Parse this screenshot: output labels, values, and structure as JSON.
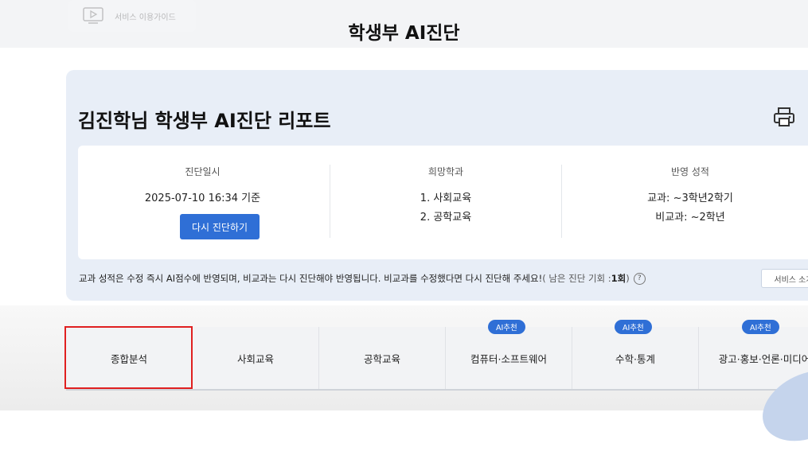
{
  "header": {
    "guide_label": "서비스 이용가이드",
    "title": "학생부 AI진단"
  },
  "report": {
    "title": "김진학님 학생부 AI진단 리포트",
    "print_icon": "printer-icon",
    "diagnosis_date": {
      "label": "진단일시",
      "value": "2025-07-10 16:34 기준",
      "button_label": "다시 진단하기"
    },
    "desired_majors": {
      "label": "희망학과",
      "items": [
        "1. 사회교육",
        "2. 공학교육"
      ]
    },
    "grades": {
      "label": "반영 성적",
      "subject": "교과: ~3학년2학기",
      "non_subject": "비교과: ~2학년"
    },
    "notice": {
      "main": "교과 성적은 수정 즉시 AI점수에 반영되며, 비교과는 다시 진단해야 반영됩니다. 비교과를 수정했다면 다시 진단해 주세요!",
      "remaining_prefix": "( 남은 진단 기회 : ",
      "remaining_count": "1회",
      "remaining_suffix": " )",
      "help_icon": "question-circle-icon"
    },
    "service_button": "서비스 소개"
  },
  "tabs": [
    {
      "label": "종합분석",
      "badge": ""
    },
    {
      "label": "사회교육",
      "badge": ""
    },
    {
      "label": "공학교육",
      "badge": ""
    },
    {
      "label": "컴퓨터·소프트웨어",
      "badge": "AI추천"
    },
    {
      "label": "수학·통계",
      "badge": "AI추천"
    },
    {
      "label": "광고·홍보·언론·미디어",
      "badge": "AI추천"
    }
  ],
  "colors": {
    "accent": "#2f6fd6",
    "highlight": "#e02020",
    "card_bg": "#e8eef7"
  }
}
